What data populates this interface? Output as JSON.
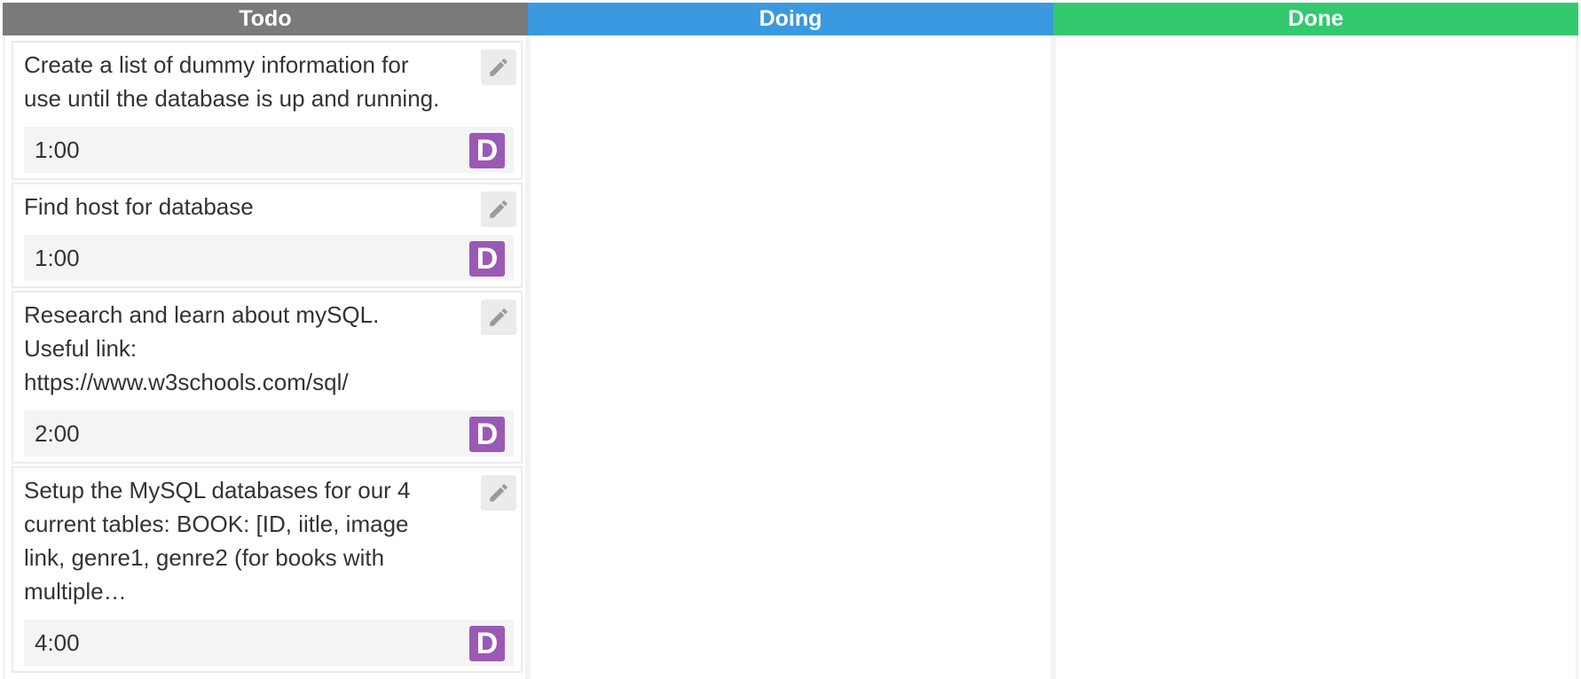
{
  "colors": {
    "todo_header": "#7a7a7a",
    "doing_header": "#3b99e0",
    "done_header": "#33c96f",
    "avatar": "#9b59b6"
  },
  "columns": [
    {
      "title": "Todo"
    },
    {
      "title": "Doing"
    },
    {
      "title": "Done"
    }
  ],
  "cards": [
    {
      "text": "Create a list of dummy information for\nuse until the database is up and running.",
      "time": "1:00",
      "avatar": "D",
      "edit_icon": "pencil-icon"
    },
    {
      "text": "Find host for database",
      "time": "1:00",
      "avatar": "D",
      "edit_icon": "pencil-icon"
    },
    {
      "text": "Research and learn about mySQL.\nUseful link:\nhttps://www.w3schools.com/sql/",
      "time": "2:00",
      "avatar": "D",
      "edit_icon": "pencil-icon"
    },
    {
      "text": "Setup the MySQL databases for our 4\ncurrent tables: BOOK: [ID, iitle, image\nlink, genre1, genre2 (for books with\nmultiple…",
      "time": "4:00",
      "avatar": "D",
      "edit_icon": "pencil-icon"
    }
  ]
}
